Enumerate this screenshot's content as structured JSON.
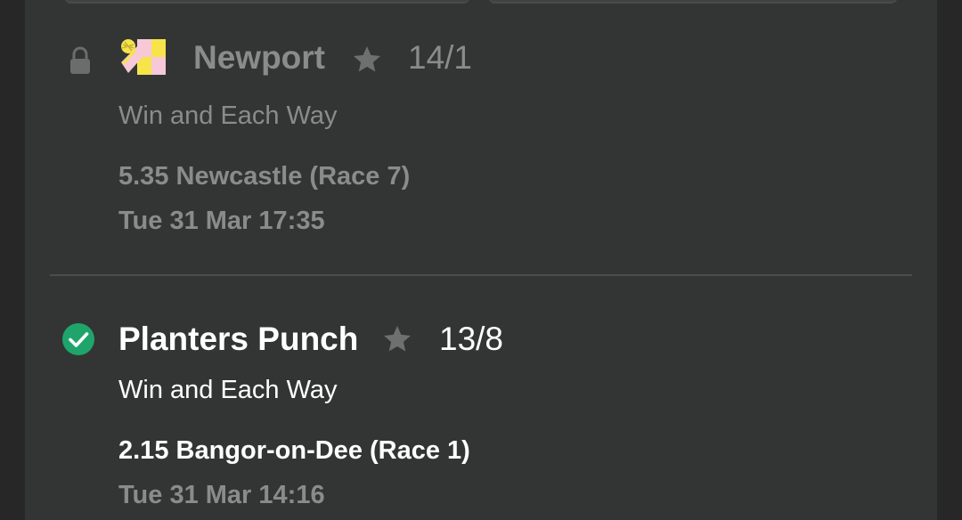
{
  "bets": [
    {
      "status_icon": "lock-icon",
      "silks_icon": "jockey-silks-icon",
      "selection": "Newport",
      "favourite_icon": "star-icon",
      "odds": "14/1",
      "bet_type": "Win and Each Way",
      "race": "5.35 Newcastle (Race 7)",
      "time": "Tue 31 Mar 17:35"
    },
    {
      "status_icon": "check-circle-icon",
      "selection": "Planters Punch",
      "favourite_icon": "star-icon",
      "odds": "13/8",
      "bet_type": "Win and Each Way",
      "race": "2.15 Bangor-on-Dee (Race 1)",
      "time": "Tue 31 Mar 14:16"
    }
  ],
  "colors": {
    "background": "#262726",
    "panel": "#333534",
    "muted_text": "#8a8c8b",
    "active_text": "#ffffff",
    "success_green": "#1fa56b",
    "star": "#6e706f"
  }
}
